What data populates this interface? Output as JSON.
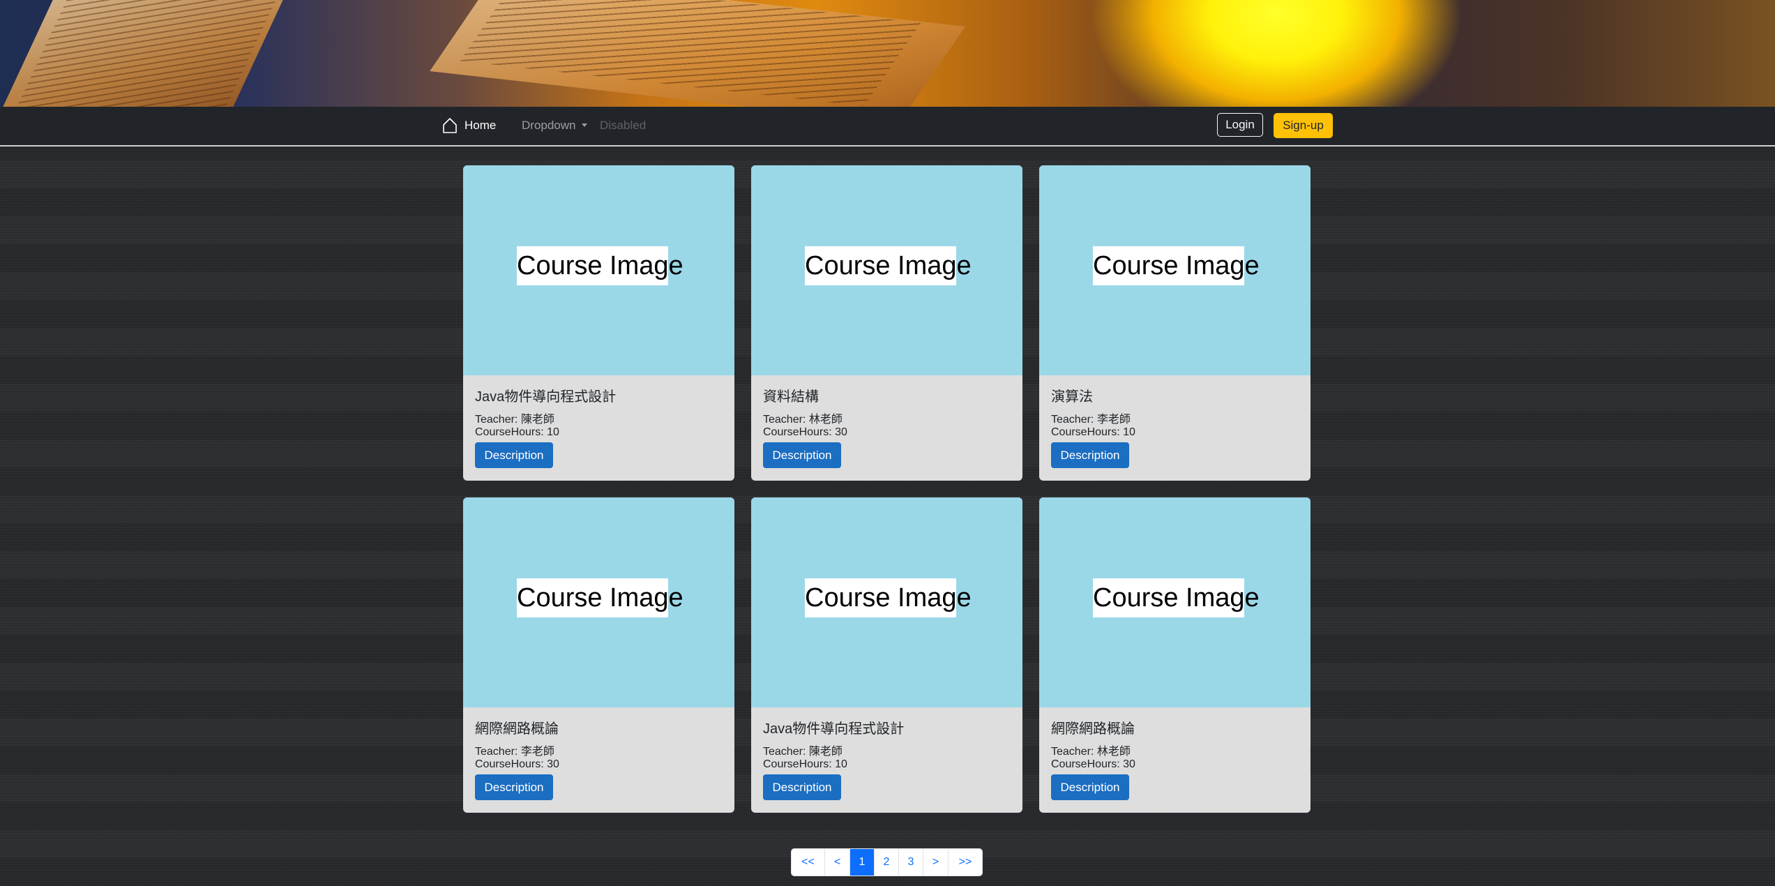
{
  "navbar": {
    "home_label": "Home",
    "dropdown_label": "Dropdown",
    "disabled_label": "Disabled",
    "login_label": "Login",
    "signup_label": "Sign-up"
  },
  "courses": [
    {
      "image_label": "Course Image",
      "title": "Java物件導向程式設計",
      "teacher": "Teacher: 陳老師",
      "hours": "CourseHours: 10",
      "button_label": "Description"
    },
    {
      "image_label": "Course Image",
      "title": "資料結構",
      "teacher": "Teacher: 林老師",
      "hours": "CourseHours: 30",
      "button_label": "Description"
    },
    {
      "image_label": "Course Image",
      "title": "演算法",
      "teacher": "Teacher: 李老師",
      "hours": "CourseHours: 10",
      "button_label": "Description"
    },
    {
      "image_label": "Course Image",
      "title": "網際網路概論",
      "teacher": "Teacher: 李老師",
      "hours": "CourseHours: 30",
      "button_label": "Description"
    },
    {
      "image_label": "Course Image",
      "title": "Java物件導向程式設計",
      "teacher": "Teacher: 陳老師",
      "hours": "CourseHours: 10",
      "button_label": "Description"
    },
    {
      "image_label": "Course Image",
      "title": "網際網路概論",
      "teacher": "Teacher: 林老師",
      "hours": "CourseHours: 30",
      "button_label": "Description"
    }
  ],
  "pagination": {
    "first": "<<",
    "prev": "<",
    "pages": [
      "1",
      "2",
      "3"
    ],
    "active_page": "1",
    "next": ">",
    "last": ">>"
  },
  "colors": {
    "navbar_bg": "#212529",
    "signup_bg": "#ffc107",
    "description_button_bg": "#1b6ec2",
    "card_image_bg": "#9ad8e8",
    "card_body_bg": "#dedede",
    "pagination_active_bg": "#0d6efd"
  },
  "icons": {
    "home": "home-icon",
    "dropdown": "caret-down-icon"
  }
}
